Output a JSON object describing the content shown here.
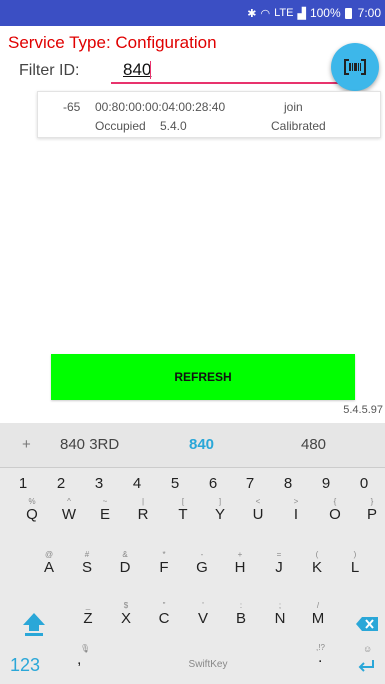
{
  "status_bar": {
    "network": "LTE",
    "battery": "100%",
    "time": "7:00"
  },
  "service": {
    "title": "Service Type: Configuration"
  },
  "filter": {
    "label": "Filter ID:",
    "value": "840"
  },
  "device": {
    "rssi": "-65",
    "mac": "00:80:00:00:04:00:28:40",
    "action": "join",
    "state": "Occupied",
    "firmware": "5.4.0",
    "calibration": "Calibrated"
  },
  "refresh_label": "REFRESH",
  "app_version": "5.4.5.97",
  "keyboard": {
    "suggestions": [
      "840 3RD",
      "840",
      "480"
    ],
    "numbers": [
      "1",
      "2",
      "3",
      "4",
      "5",
      "6",
      "7",
      "8",
      "9",
      "0"
    ],
    "row1": [
      {
        "k": "Q",
        "h": "%"
      },
      {
        "k": "W",
        "h": "^"
      },
      {
        "k": "E",
        "h": "~"
      },
      {
        "k": "R",
        "h": "|"
      },
      {
        "k": "T",
        "h": "["
      },
      {
        "k": "Y",
        "h": "]"
      },
      {
        "k": "U",
        "h": "<"
      },
      {
        "k": "I",
        "h": ">"
      },
      {
        "k": "O",
        "h": "{"
      },
      {
        "k": "P",
        "h": "}"
      }
    ],
    "row2": [
      {
        "k": "A",
        "h": "@"
      },
      {
        "k": "S",
        "h": "#"
      },
      {
        "k": "D",
        "h": "&"
      },
      {
        "k": "F",
        "h": "*"
      },
      {
        "k": "G",
        "h": "-"
      },
      {
        "k": "H",
        "h": "+"
      },
      {
        "k": "J",
        "h": "="
      },
      {
        "k": "K",
        "h": "("
      },
      {
        "k": "L",
        "h": ")"
      }
    ],
    "row3": [
      {
        "k": "Z",
        "h": "_"
      },
      {
        "k": "X",
        "h": "$"
      },
      {
        "k": "C",
        "h": "\""
      },
      {
        "k": "V",
        "h": "'"
      },
      {
        "k": "B",
        "h": ":"
      },
      {
        "k": "N",
        "h": ";"
      },
      {
        "k": "M",
        "h": "/"
      }
    ],
    "numbers_switch": "123",
    "comma": ",",
    "space_label": "SwiftKey",
    "period": ".",
    "period_hint": ",!?"
  },
  "colors": {
    "status_bar": "#3b4fc4",
    "title": "#e00000",
    "accent": "#3db7ea",
    "input_underline": "#e8336d",
    "refresh_button": "#00ff00"
  },
  "icons": [
    "bluetooth-icon",
    "wifi-icon",
    "signal-icon",
    "battery-icon",
    "barcode-icon",
    "shift-icon",
    "backspace-icon",
    "enter-icon",
    "mic-icon",
    "emoji-icon"
  ]
}
